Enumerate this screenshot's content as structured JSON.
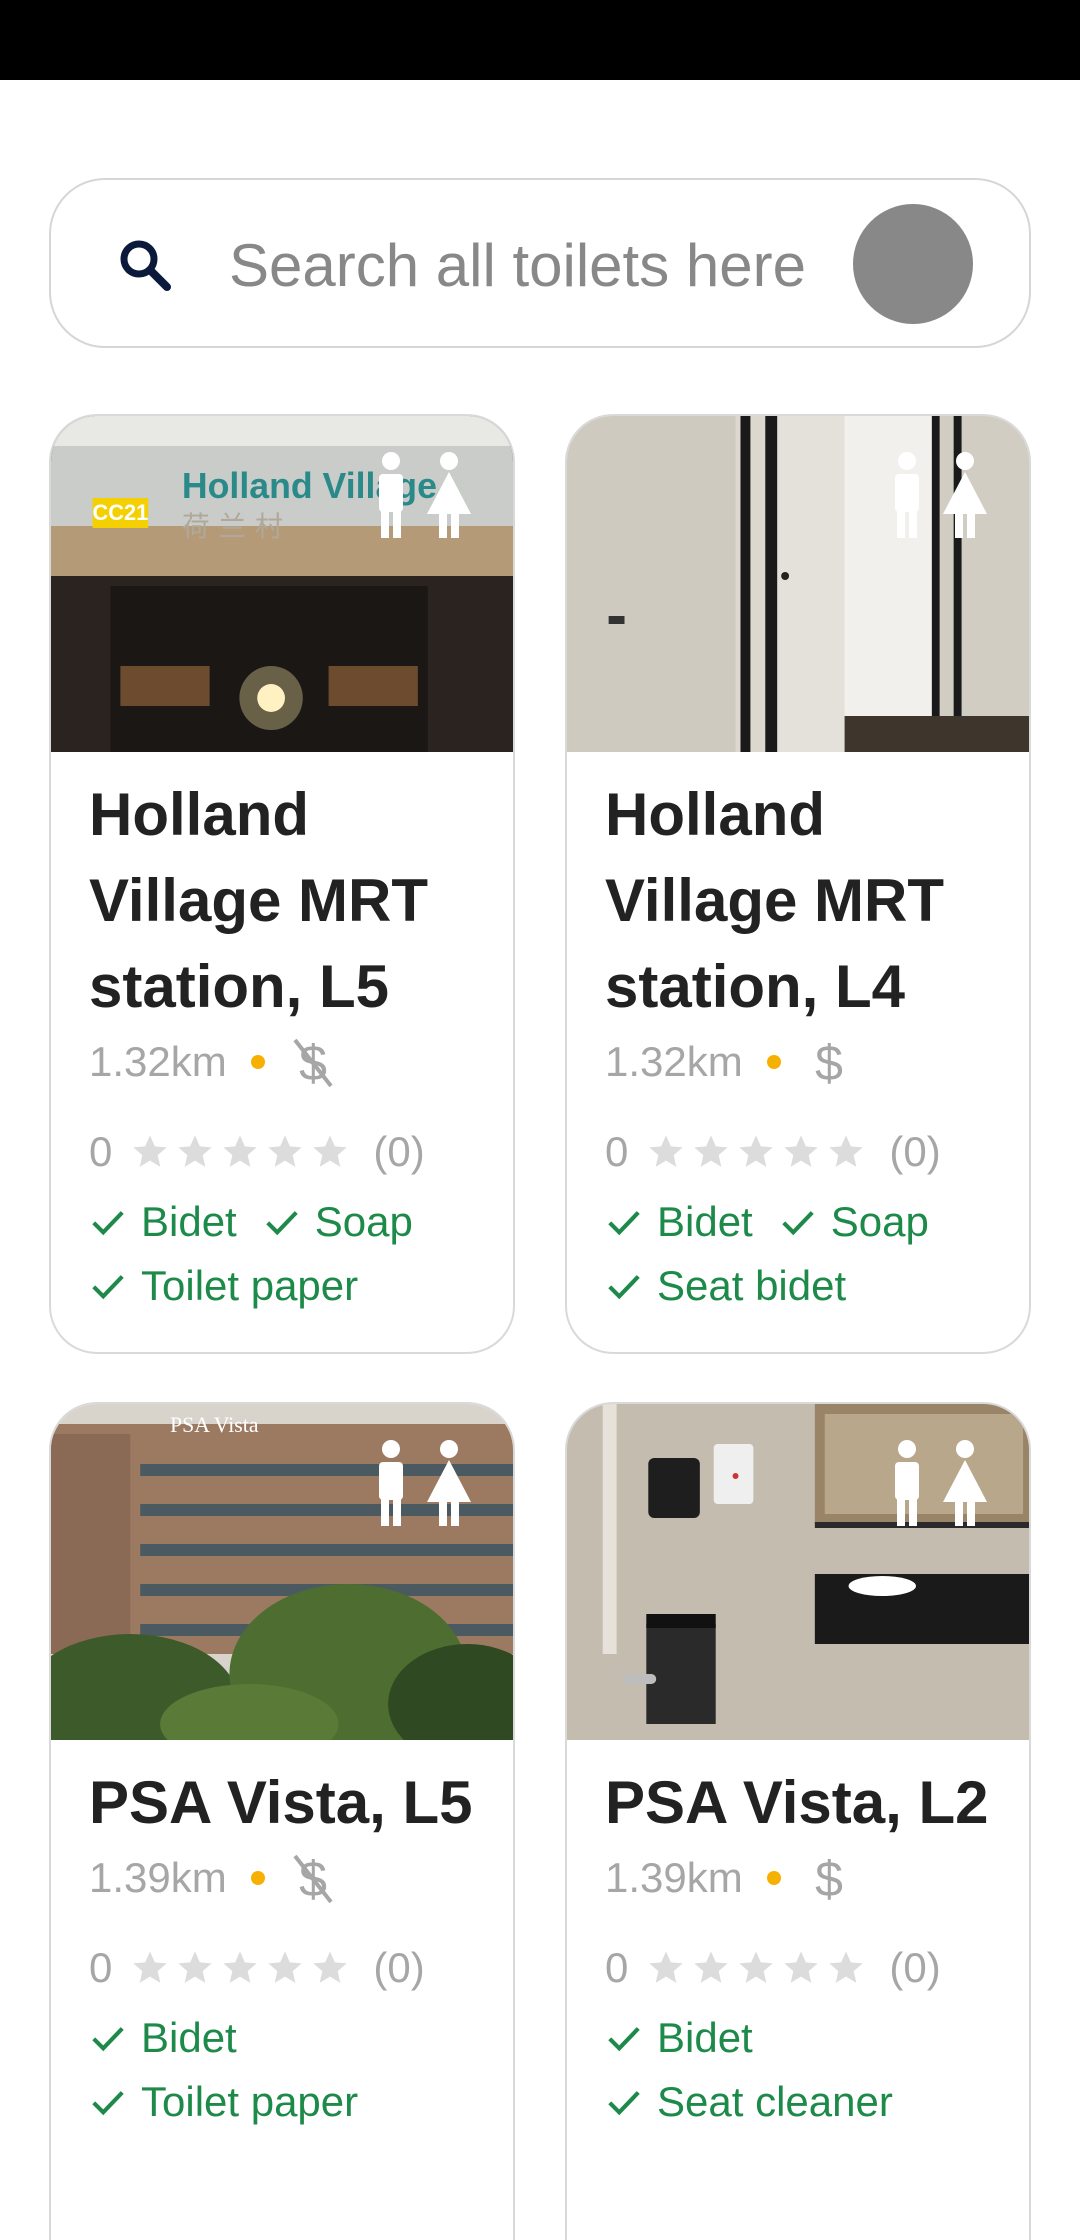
{
  "search": {
    "placeholder": "Search all toilets here"
  },
  "colors": {
    "accent_green": "#1e8a4a",
    "dot_yellow": "#f6b100",
    "muted_gray": "#a6a6a6"
  },
  "icons": {
    "search": "search-icon",
    "gender": "male-female-icon",
    "free": "no-dollar-icon",
    "paid": "dollar-icon",
    "star": "star-icon",
    "check": "check-icon"
  },
  "cards": [
    {
      "name": "Holland Village MRT station, L5",
      "distance": "1.32km",
      "price": "free",
      "rating_value": "0",
      "stars": 0,
      "rating_count": "(0)",
      "features": [
        "Bidet",
        "Soap",
        "Toilet paper"
      ]
    },
    {
      "name": "Holland Village MRT station, L4",
      "distance": "1.32km",
      "price": "paid",
      "rating_value": "0",
      "stars": 0,
      "rating_count": "(0)",
      "features": [
        "Bidet",
        "Soap",
        "Seat bidet"
      ]
    },
    {
      "name": "PSA Vista, L5",
      "distance": "1.39km",
      "price": "free",
      "rating_value": "0",
      "stars": 0,
      "rating_count": "(0)",
      "features": [
        "Bidet",
        "Toilet paper"
      ]
    },
    {
      "name": "PSA Vista, L2",
      "distance": "1.39km",
      "price": "paid",
      "rating_value": "0",
      "stars": 0,
      "rating_count": "(0)",
      "features": [
        "Bidet",
        "Seat cleaner"
      ]
    }
  ],
  "photo_text": {
    "station_code": "CC21",
    "station_en": "Holland Village",
    "station_cn": "荷 兰 村",
    "building_sign": "PSA Vista"
  }
}
